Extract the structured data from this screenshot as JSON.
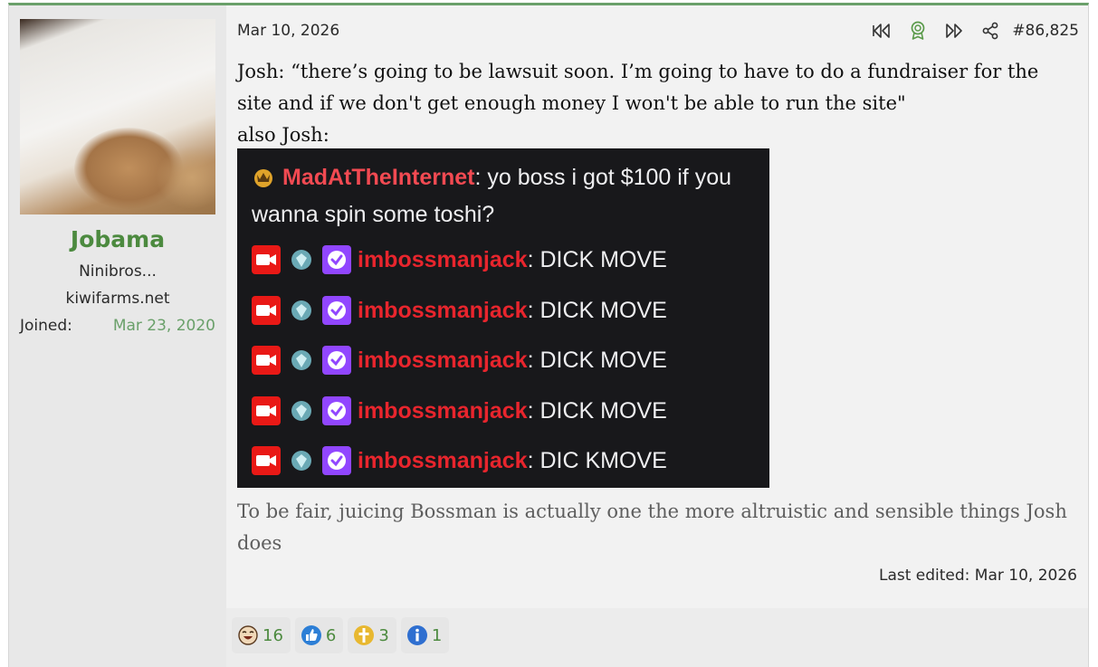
{
  "user": {
    "name": "Jobama",
    "title": "Ninibros...",
    "banner": "kiwifarms.net",
    "joined_label": "Joined:",
    "joined_value": "Mar 23, 2020"
  },
  "post": {
    "date": "Mar 10, 2026",
    "number": "#86,825",
    "icons": [
      "rewind-icon",
      "award-icon",
      "fast-forward-icon",
      "share-icon"
    ],
    "text_line1": "Josh: “there’s going to be lawsuit soon. I’m going to have to do a fundraiser for the site and if we don't get enough money I won't be able to run the site\"",
    "text_line2": "also Josh:",
    "embed": {
      "first_user": "MadAtTheInternet",
      "first_message": ": yo boss i got $100 if you wanna spin some toshi?",
      "lines": [
        {
          "user": "imbossmanjack",
          "message": ": DICK MOVE"
        },
        {
          "user": "imbossmanjack",
          "message": ": DICK MOVE"
        },
        {
          "user": "imbossmanjack",
          "message": ": DICK MOVE"
        },
        {
          "user": "imbossmanjack",
          "message": ": DICK MOVE"
        },
        {
          "user": "imbossmanjack",
          "message": ": DIC KMOVE"
        }
      ],
      "badge_icons": [
        "camera-badge-icon",
        "gem-badge-icon",
        "verified-badge-icon"
      ]
    },
    "quote": "To be fair, juicing Bossman is actually one the more altruistic and sensible things Josh does",
    "last_edited": "Last edited: Mar 10, 2026"
  },
  "reactions": [
    {
      "icon": "laughing-face-icon",
      "count": "16"
    },
    {
      "icon": "thumbs-up-icon",
      "count": "6"
    },
    {
      "icon": "cross-icon",
      "count": "3"
    },
    {
      "icon": "info-icon",
      "count": "1"
    }
  ],
  "colors": {
    "accent": "#4c8a3f",
    "username_red": "#e8252d",
    "twitch_purple": "#9146ff"
  }
}
